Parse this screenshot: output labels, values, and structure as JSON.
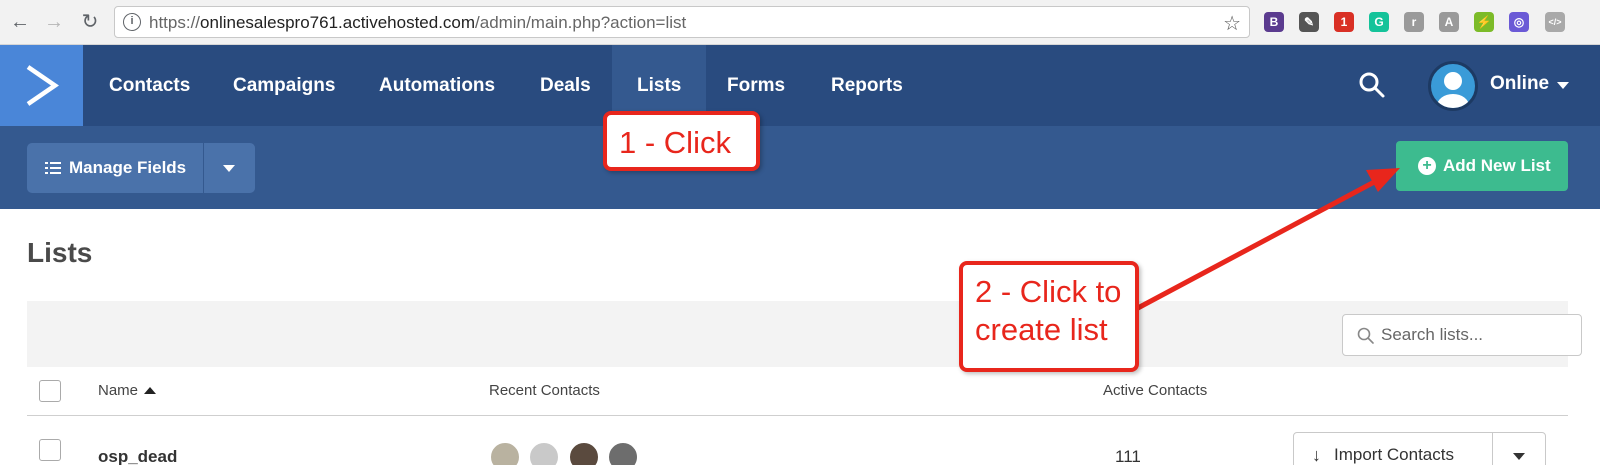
{
  "browser": {
    "url_prefix": "https://",
    "url_host": "onlinesalespro761.activehosted.com",
    "url_path": "/admin/main.php?action=list",
    "back_icon": "back-arrow-icon",
    "forward_icon": "forward-arrow-icon",
    "reload_icon": "reload-icon",
    "bookmark_icon": "star-icon",
    "extensions": [
      {
        "name": "b-extension-icon",
        "glyph": "B",
        "color": "#5b3b8f"
      },
      {
        "name": "eyedropper-extension-icon",
        "glyph": "✎",
        "color": "#555555"
      },
      {
        "name": "todo-extension-icon",
        "glyph": "1",
        "color": "#d93025"
      },
      {
        "name": "grammarly-extension-icon",
        "glyph": "G",
        "color": "#15c39a"
      },
      {
        "name": "r-extension-icon",
        "glyph": "r",
        "color": "#9a9a9a"
      },
      {
        "name": "a-extension-icon",
        "glyph": "A",
        "color": "#9a9a9a"
      },
      {
        "name": "green-extension-icon",
        "glyph": "⚡",
        "color": "#7cbb28"
      },
      {
        "name": "circle-extension-icon",
        "glyph": "◎",
        "color": "#6b5ad6"
      },
      {
        "name": "code-extension-icon",
        "glyph": "</>",
        "color": "#a9a9a9"
      }
    ]
  },
  "nav": {
    "items": [
      {
        "label": "Contacts",
        "active": false
      },
      {
        "label": "Campaigns",
        "active": false
      },
      {
        "label": "Automations",
        "active": false
      },
      {
        "label": "Deals",
        "active": false
      },
      {
        "label": "Lists",
        "active": true
      },
      {
        "label": "Forms",
        "active": false
      },
      {
        "label": "Reports",
        "active": false
      }
    ],
    "user_name": "Online",
    "colors": {
      "nav_bg": "#294b7f",
      "logo_bg": "#4a86d8",
      "active_bg": "#34598f"
    }
  },
  "toolbar": {
    "manage_fields_label": "Manage Fields",
    "add_new_list_label": "Add New List",
    "colors": {
      "toolbar_bg": "#34598f",
      "add_button": "#3dbb8f"
    }
  },
  "main": {
    "title": "Lists",
    "search_placeholder": "Search lists...",
    "columns": {
      "name": "Name",
      "recent_contacts": "Recent Contacts",
      "active_contacts": "Active Contacts"
    },
    "rows": [
      {
        "name": "osp_dead",
        "active_contacts": "111",
        "action": "Import Contacts"
      }
    ]
  },
  "annotations": {
    "callout_1": "1 - Click",
    "callout_2_line1": "2 - Click to",
    "callout_2_line2": "create list",
    "color": "#e8261c"
  }
}
